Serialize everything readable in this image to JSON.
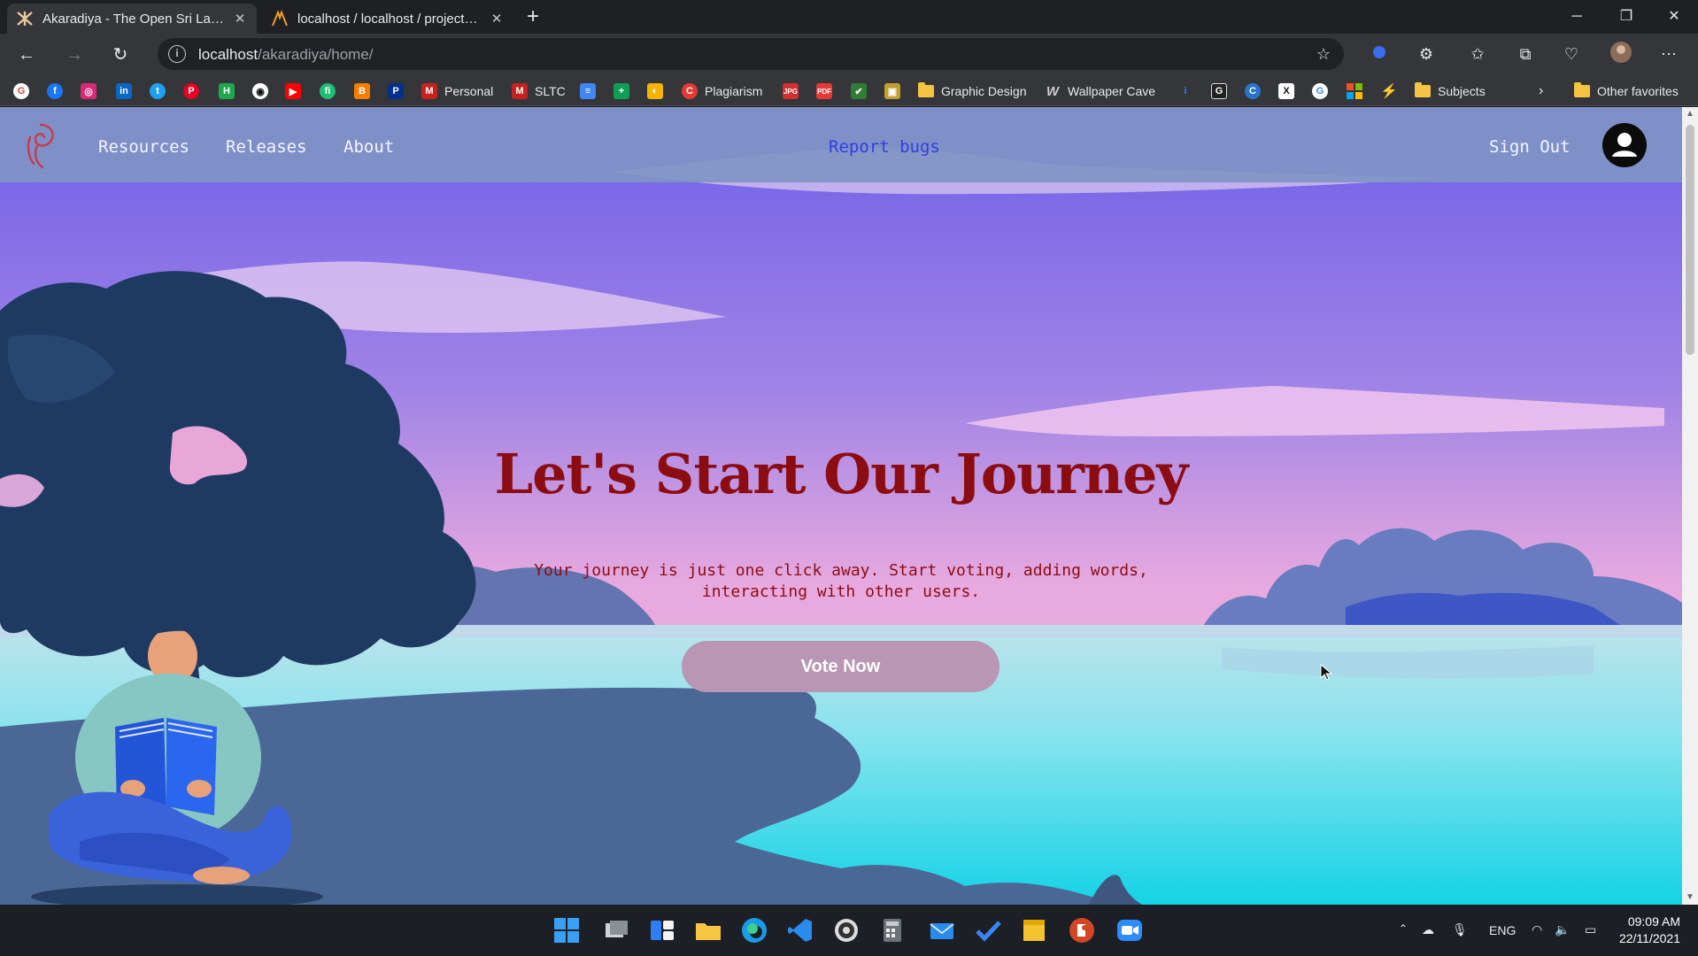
{
  "browser": {
    "tabs": [
      {
        "title": "Akaradiya - The Open Sri Lankan",
        "active": true
      },
      {
        "title": "localhost / localhost / project_ak",
        "active": false
      }
    ],
    "url_host": "localhost",
    "url_path": "/akaradiya/home/",
    "bookmarks": {
      "personal": "Personal",
      "sltc": "SLTC",
      "plagiarism": "Plagiarism",
      "graphic_design": "Graphic Design",
      "wallpaper_cave": "Wallpaper Cave",
      "subjects": "Subjects",
      "other_favorites": "Other favorites"
    }
  },
  "site": {
    "nav": {
      "resources": "Resources",
      "releases": "Releases",
      "about": "About",
      "report_bugs": "Report bugs",
      "sign_out": "Sign Out"
    },
    "hero": {
      "title": "Let's Start Our Journey",
      "text_line1": "Your journey is just one click away. Start voting, adding words,",
      "text_line2": "interacting with other users.",
      "button": "Vote Now"
    }
  },
  "taskbar": {
    "language": "ENG",
    "time": "09:09 AM",
    "date": "22/11/2021"
  },
  "colors": {
    "hero_text": "#8b0d12",
    "nav_bg": "#8094c4",
    "report_bugs": "#2f3fe0",
    "button_bg": "#b896b4"
  }
}
